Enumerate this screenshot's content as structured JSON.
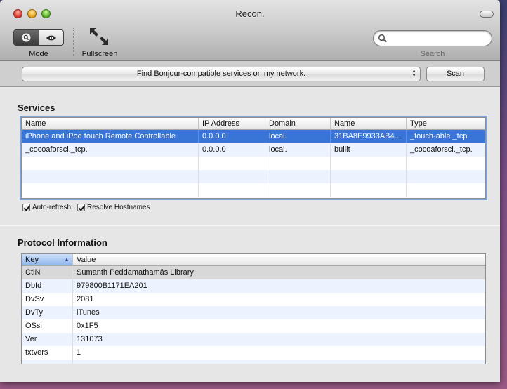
{
  "window": {
    "title": "Recon."
  },
  "toolbar": {
    "mode_label": "Mode",
    "fullscreen_label": "Fullscreen",
    "search_label": "Search",
    "search_value": "",
    "search_placeholder": ""
  },
  "bonjour": {
    "popup_label": "Find Bonjour-compatible services on my network.",
    "scan_label": "Scan"
  },
  "services": {
    "title": "Services",
    "columns": [
      "Name",
      "IP Address",
      "Domain",
      "Name",
      "Type"
    ],
    "rows": [
      [
        "iPhone and iPod touch Remote Controllable",
        "0.0.0.0",
        "local.",
        "31BA8E9933AB4...",
        "_touch-able._tcp."
      ],
      [
        "_cocoaforsci._tcp.",
        "0.0.0.0",
        "local.",
        "bullit",
        "_cocoaforsci._tcp."
      ]
    ],
    "selected_row": 0,
    "auto_refresh_label": "Auto-refresh",
    "resolve_hostnames_label": "Resolve Hostnames"
  },
  "protocol": {
    "title": "Protocol Information",
    "columns": [
      "Key",
      "Value"
    ],
    "rows": [
      [
        "CtlN",
        "Sumanth Peddamathamâs Library"
      ],
      [
        "DbId",
        "979800B1171EA201"
      ],
      [
        "DvSv",
        "2081"
      ],
      [
        "DvTy",
        "iTunes"
      ],
      [
        "OSsi",
        "0x1F5"
      ],
      [
        "Ver",
        "131073"
      ],
      [
        "txtvers",
        "1"
      ]
    ]
  },
  "colors": {
    "selection": "#3875d7",
    "alt_row": "#edf3fe",
    "focus_ring": "#7fa3d8"
  }
}
